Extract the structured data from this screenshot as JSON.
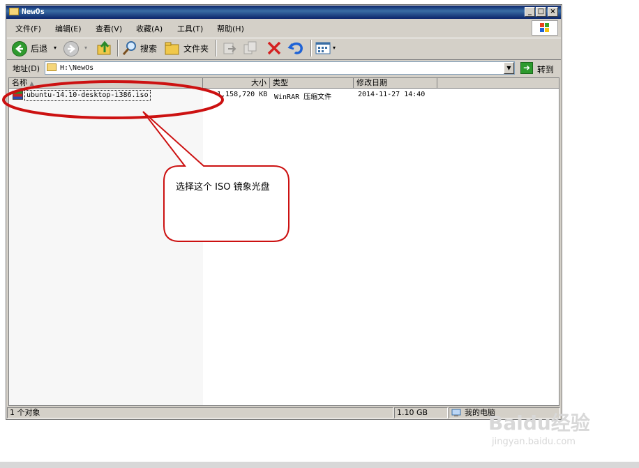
{
  "window": {
    "title": "NewOs"
  },
  "title_buttons": {
    "minimize": "_",
    "maximize": "□",
    "close": "×"
  },
  "menu": [
    "文件(F)",
    "编辑(E)",
    "查看(V)",
    "收藏(A)",
    "工具(T)",
    "帮助(H)"
  ],
  "toolbar": {
    "back_label": "后退",
    "search_label": "搜索",
    "folders_label": "文件夹"
  },
  "address": {
    "label": "地址(D)",
    "path": "H:\\NewOs",
    "go_label": "转到"
  },
  "columns": [
    "名称",
    "大小",
    "类型",
    "修改日期"
  ],
  "files": [
    {
      "name": "ubuntu-14.10-desktop-i386.iso",
      "size": "1,158,720 KB",
      "type": "WinRAR 压缩文件",
      "modified": "2014-11-27 14:40"
    }
  ],
  "status": {
    "count": "1 个对象",
    "size": "1.10 GB",
    "location": "我的电脑"
  },
  "annotation": {
    "text": "选择这个 ISO 镜象光盘",
    "color": "#cc1111"
  },
  "watermark": {
    "brand": "Baidu经验",
    "url": "jingyan.baidu.com"
  }
}
